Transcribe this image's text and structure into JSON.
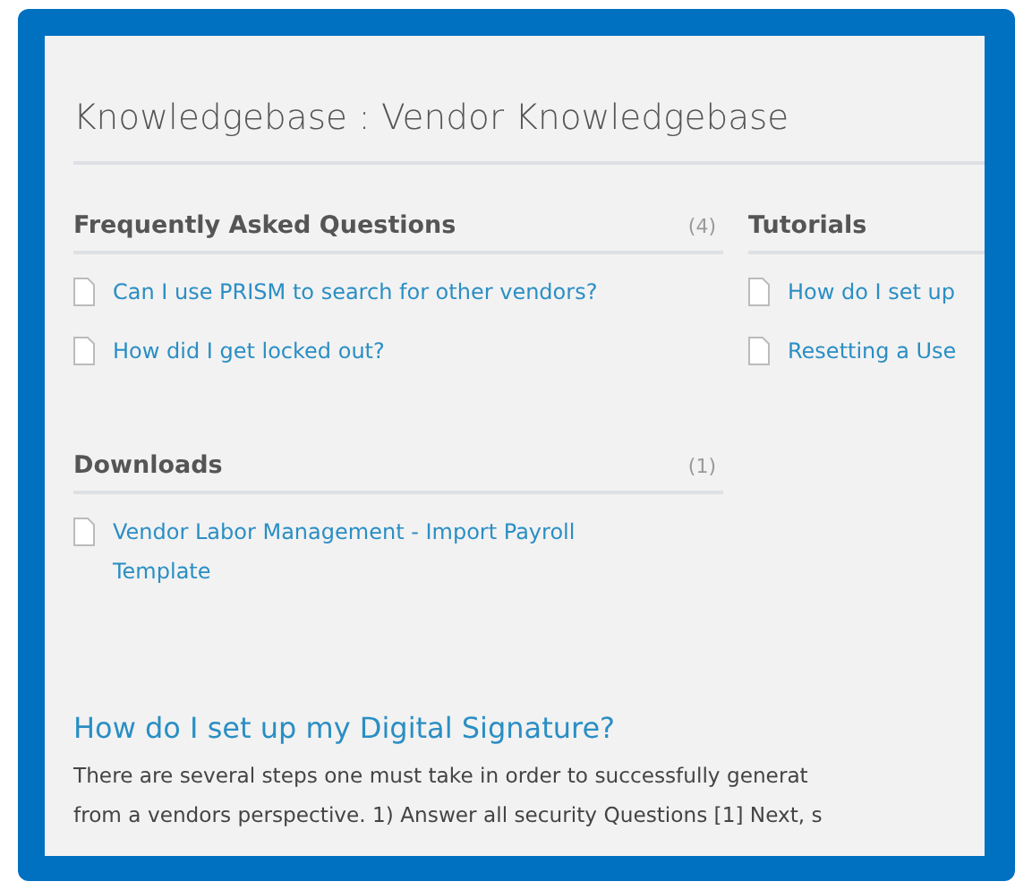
{
  "title": "Knowledgebase : Vendor Knowledgebase",
  "columns": [
    [
      {
        "heading": "Frequently Asked Questions",
        "count": "(4)",
        "items": [
          "Can I use PRISM to search for other vendors?",
          "How did I get locked out?"
        ]
      },
      {
        "heading": "Downloads",
        "count": "(1)",
        "items": [
          "Vendor Labor Management - Import Payroll Template"
        ]
      }
    ],
    [
      {
        "heading": "Tutorials",
        "items": [
          "How do I set up",
          "Resetting a Use"
        ]
      }
    ]
  ],
  "article": {
    "title": "How do I set up my Digital Signature?",
    "lines": [
      "There are several steps one must take in order to successfully generat",
      "from a vendors perspective. 1) Answer all security Questions [1] Next, s"
    ]
  }
}
